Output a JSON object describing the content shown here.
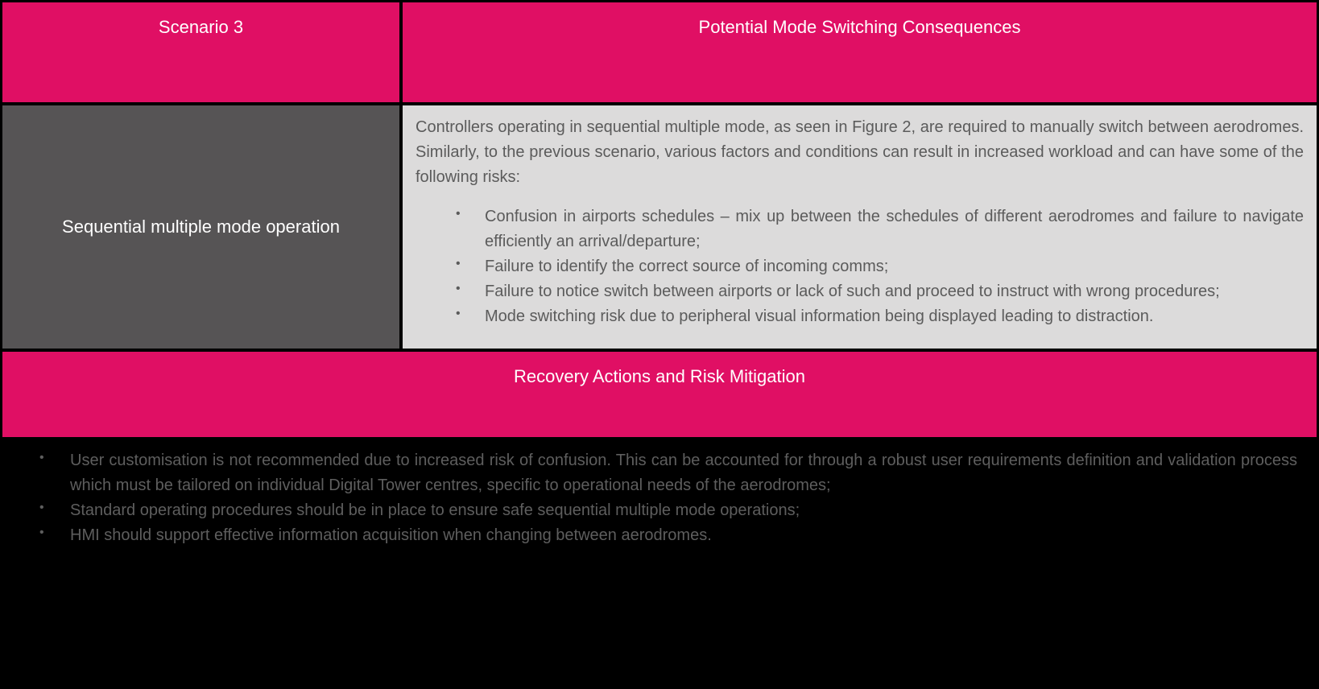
{
  "colors": {
    "accent": "#e00f64",
    "darkCell": "#565455",
    "lightCell": "#dcdbdb",
    "black": "#000000",
    "textGrey": "#5b5b5b",
    "darkTextGrey": "#5e5e5e"
  },
  "header": {
    "left": "Scenario 3",
    "right": "Potential Mode Switching Consequences"
  },
  "scenario": {
    "title": "Sequential multiple mode operation",
    "intro": "Controllers operating in sequential multiple mode, as seen in Figure 2, are required to manually switch between aerodromes.  Similarly, to the previous scenario, various factors and conditions can result in increased workload and can have some of the following risks:",
    "risks": [
      "Confusion in airports schedules – mix up between the schedules of different aerodromes and failure to navigate efficiently an arrival/departure;",
      "Failure to identify the correct source of incoming comms;",
      "Failure to notice switch between airports or lack of such and proceed to instruct with wrong procedures;",
      "Mode switching risk due to peripheral visual information being displayed leading to distraction."
    ]
  },
  "recovery": {
    "title": "Recovery Actions and Risk Mitigation",
    "items": [
      "User customisation is not recommended due to increased risk of confusion.  This can be accounted for through a robust user requirements definition and validation process which must be tailored on individual Digital Tower centres, specific to operational needs of the aerodromes;",
      "Standard operating procedures should be in place to ensure safe sequential multiple mode operations;",
      "HMI should support effective information acquisition when changing between aerodromes."
    ]
  }
}
